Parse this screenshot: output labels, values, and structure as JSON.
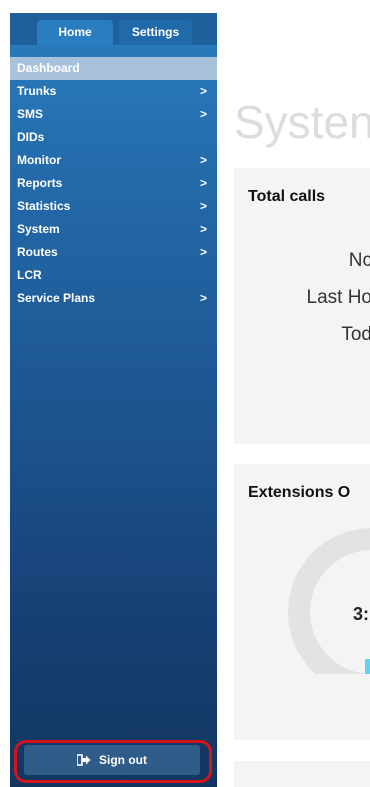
{
  "sidebar": {
    "tabs": [
      {
        "label": "Home",
        "active": true
      },
      {
        "label": "Settings",
        "active": false
      }
    ],
    "items": [
      {
        "label": "Dashboard",
        "active": true,
        "has_submenu": false
      },
      {
        "label": "Trunks",
        "active": false,
        "has_submenu": true
      },
      {
        "label": "SMS",
        "active": false,
        "has_submenu": true
      },
      {
        "label": "DIDs",
        "active": false,
        "has_submenu": false
      },
      {
        "label": "Monitor",
        "active": false,
        "has_submenu": true
      },
      {
        "label": "Reports",
        "active": false,
        "has_submenu": true
      },
      {
        "label": "Statistics",
        "active": false,
        "has_submenu": true
      },
      {
        "label": "System",
        "active": false,
        "has_submenu": true
      },
      {
        "label": "Routes",
        "active": false,
        "has_submenu": true
      },
      {
        "label": "LCR",
        "active": false,
        "has_submenu": false
      },
      {
        "label": "Service Plans",
        "active": false,
        "has_submenu": true
      }
    ],
    "chevron": ">",
    "signout_label": "Sign out"
  },
  "main": {
    "page_title": "Systen",
    "total_calls": {
      "title": "Total calls",
      "labels": [
        "Nc",
        "Last Ho",
        "Tod"
      ]
    },
    "extensions": {
      "title": "Extensions O",
      "donut_value": "3:"
    }
  },
  "colors": {
    "sidebar_top": "#2a7dbf",
    "sidebar_bottom": "#12365f",
    "active_item": "#a8c2dc",
    "highlight_border": "#d4151d",
    "panel_bg": "#f4f4f4",
    "donut_track": "#e3e3e3",
    "donut_accent": "#5fd3ef"
  }
}
